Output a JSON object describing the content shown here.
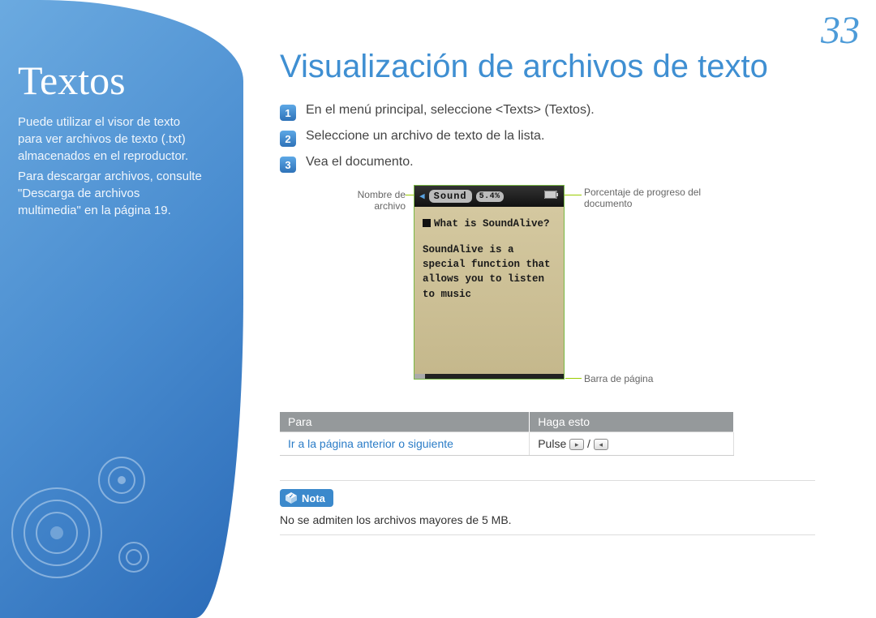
{
  "page_number": "33",
  "sidebar": {
    "title": "Textos",
    "para1": "Puede utilizar el visor de texto para ver archivos de texto (.txt) almacenados en el reproductor.",
    "para2": "Para descargar archivos, consulte \"Descarga de archivos multimedia\" en la página 19."
  },
  "main": {
    "title": "Visualización de archivos de texto",
    "steps": [
      {
        "n": "1",
        "t": "En el menú principal, seleccione <Texts> (Textos)."
      },
      {
        "n": "2",
        "t": "Seleccione un archivo de texto de la lista."
      },
      {
        "n": "3",
        "t": "Vea el documento."
      }
    ],
    "callouts": {
      "filename": "Nombre de archivo",
      "progress": "Porcentaje de progreso del documento",
      "pagebar": "Barra de página"
    },
    "device": {
      "status_file": "Sound",
      "status_pct": "5.4%",
      "line1": "What is SoundAlive?",
      "line2": "SoundAlive is a special function that allows you to listen to music"
    },
    "table": {
      "h1": "Para",
      "h2": "Haga esto",
      "r1c1": "Ir a la página anterior o siguiente",
      "r1c2": "Pulse",
      "slash": "/"
    },
    "note": {
      "label": "Nota",
      "text": "No se admiten los archivos mayores de 5 MB."
    }
  }
}
